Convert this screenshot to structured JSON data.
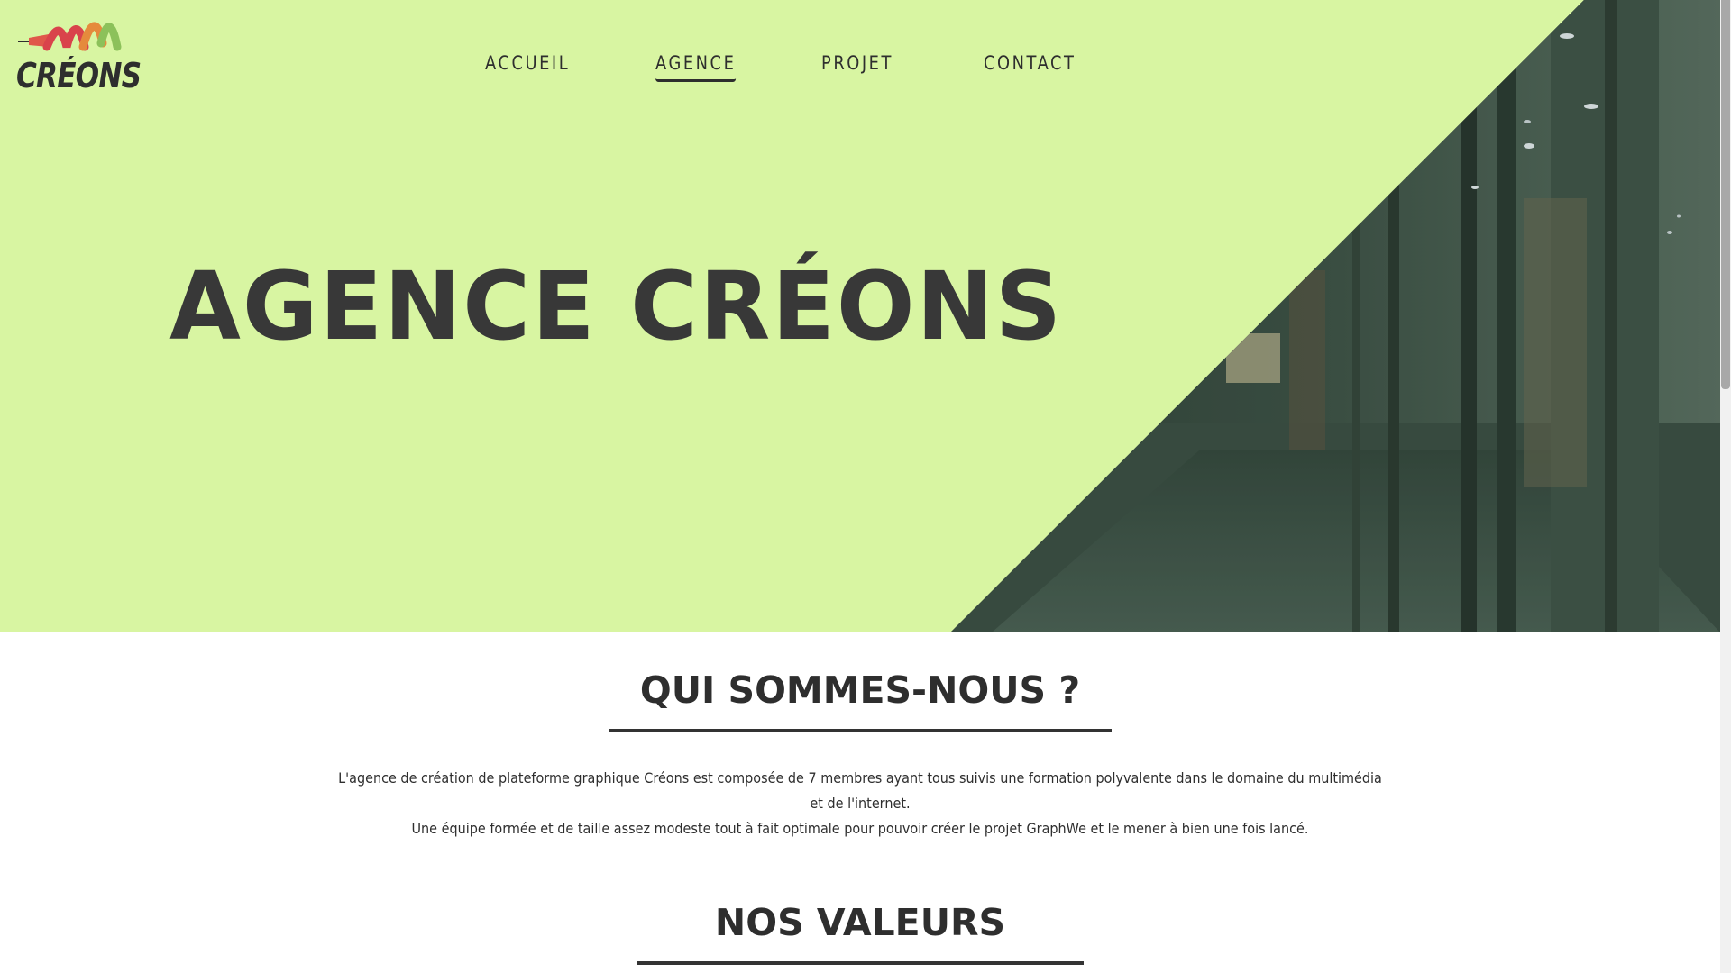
{
  "brand": {
    "logo_text": "CRÉONS"
  },
  "nav": {
    "items": [
      {
        "label": "ACCUEIL",
        "active": false
      },
      {
        "label": "AGENCE",
        "active": true
      },
      {
        "label": "PROJET",
        "active": false
      },
      {
        "label": "CONTACT",
        "active": false
      }
    ]
  },
  "hero": {
    "title": "AGENCE CRÉONS",
    "background_color": "#d8f5a2",
    "image": "office-hallway-photo"
  },
  "about": {
    "title": "QUI SOMMES-NOUS ?",
    "paragraphs": [
      "L'agence de création de plateforme graphique Créons est composée de 7 membres ayant tous suivis une formation polyvalente dans le domaine du multimédia et de l'internet.",
      "Une équipe formée et de taille assez modeste tout à fait optimale pour pouvoir créer le projet GraphWe et le mener à bien une fois lancé."
    ]
  },
  "values": {
    "title": "NOS VALEURS"
  },
  "colors": {
    "text": "#2e2e2e",
    "accent": "#d8f5a2",
    "photo_tint": "#3f5548"
  }
}
